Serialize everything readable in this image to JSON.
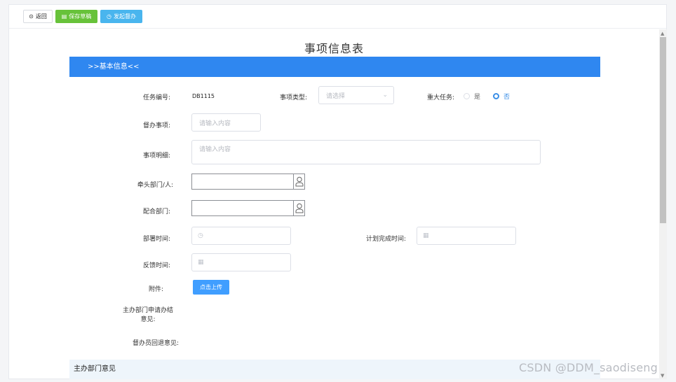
{
  "toolbar": {
    "back_label": "返回",
    "save_label": "保存草稿",
    "submit_label": "发起督办"
  },
  "form": {
    "title": "事项信息表",
    "section_basic": ">>基本信息<<",
    "task_no_label": "任务编号:",
    "task_no_value": "DB1115",
    "item_type_label": "事项类型:",
    "item_type_placeholder": "请选择",
    "major_task_label": "重大任务:",
    "major_options": [
      "是",
      "否"
    ],
    "major_selected": "否",
    "supervise_item_label": "督办事项:",
    "supervise_item_placeholder": "请输入内容",
    "item_detail_label": "事项明细:",
    "item_detail_placeholder": "请输入内容",
    "lead_dept_label": "牵头部门/人:",
    "coop_dept_label": "配合部门:",
    "deploy_time_label": "部署时间:",
    "plan_finish_label": "计划完成时间:",
    "feedback_time_label": "反馈时间:",
    "attachment_label": "附件:",
    "upload_label": "点击上传",
    "host_apply_label_1": "主办部门申请办结",
    "host_apply_label_2": "意见:",
    "officer_return_label": "督办员回退意见:",
    "section_host": "主办部门意见"
  },
  "icons": {
    "back": "circle-dot-icon",
    "save": "floppy-icon",
    "submit": "clock-icon",
    "person": "person-icon",
    "calendar": "calendar-icon",
    "clock": "clock-icon",
    "chevron": "chevron-down-icon"
  },
  "colors": {
    "primary": "#2f87f0",
    "save_green": "#67c23a",
    "submit_blue": "#49b5ee",
    "radio_active": "#3a8ee6"
  },
  "watermark": "CSDN @DDM_saodiseng"
}
